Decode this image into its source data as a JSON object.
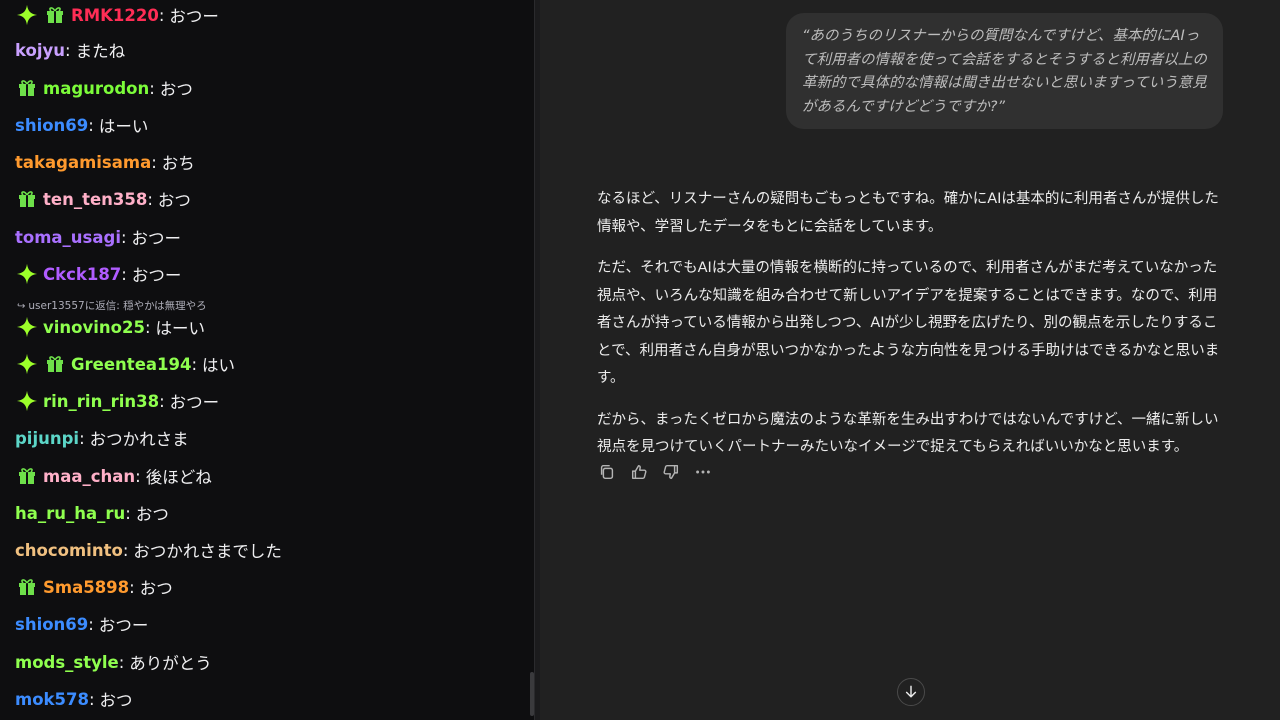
{
  "chat": {
    "messages": [
      {
        "user": "RMK1220",
        "text": "おつー",
        "color": "#ff2d55",
        "badges": [
          "sparkle-icon",
          "gift-icon"
        ]
      },
      {
        "user": "kojyu",
        "text": "またね",
        "color": "#c9a0ff",
        "badges": []
      },
      {
        "user": "magurodon",
        "text": "おつ",
        "color": "#7cfc3a",
        "badges": [
          "gift-icon"
        ]
      },
      {
        "user": "shion69",
        "text": "はーい",
        "color": "#3c8cff",
        "badges": []
      },
      {
        "user": "takagamisama",
        "text": "おち",
        "color": "#ff9a2e",
        "badges": []
      },
      {
        "user": "ten_ten358",
        "text": "おつ",
        "color": "#ffb0c8",
        "badges": [
          "gift-icon"
        ]
      },
      {
        "user": "toma_usagi",
        "text": "おつー",
        "color": "#a970ff",
        "badges": []
      },
      {
        "user": "Ckck187",
        "text": "おつー",
        "color": "#b05cff",
        "badges": [
          "sparkle-icon"
        ]
      },
      {
        "user": "vinovino25",
        "text": "はーい",
        "color": "#8fff4f",
        "badges": [
          "sparkle-icon"
        ]
      },
      {
        "user": "Greentea194",
        "text": "はい",
        "color": "#8fff4f",
        "badges": [
          "sparkle-icon",
          "gift-icon"
        ]
      },
      {
        "user": "rin_rin_rin38",
        "text": "おつー",
        "color": "#8fff4f",
        "badges": [
          "sparkle-icon"
        ]
      },
      {
        "user": "pijunpi",
        "text": "おつかれさま",
        "color": "#5cd6c8",
        "badges": []
      },
      {
        "user": "maa_chan",
        "text": "後ほどね",
        "color": "#ffb0c8",
        "badges": [
          "gift-icon"
        ]
      },
      {
        "user": "ha_ru_ha_ru",
        "text": "おつ",
        "color": "#8fff4f",
        "badges": []
      },
      {
        "user": "chocominto",
        "text": "おつかれさまでした",
        "color": "#f0c080",
        "badges": []
      },
      {
        "user": "Sma5898",
        "text": "おつ",
        "color": "#ff9a2e",
        "badges": [
          "gift-icon"
        ]
      },
      {
        "user": "shion69",
        "text": "おつー",
        "color": "#3c8cff",
        "badges": []
      },
      {
        "user": "mods_style",
        "text": "ありがとう",
        "color": "#8fff4f",
        "badges": []
      },
      {
        "user": "mok578",
        "text": "おつ",
        "color": "#3c8cff",
        "badges": []
      }
    ],
    "reply_context": "user13557に返信: 穏やかは無理やろ"
  },
  "assistant": {
    "user_message": "“あのうちのリスナーからの質問なんですけど、基本的にAIって利用者の情報を使って会話をするとそうすると利用者以上の革新的で具体的な情報は聞き出せないと思いますっていう意見があるんですけどどうですか?”",
    "answer": [
      "なるほど、リスナーさんの疑問もごもっともですね。確かにAIは基本的に利用者さんが提供した情報や、学習したデータをもとに会話をしています。",
      "ただ、それでもAIは大量の情報を横断的に持っているので、利用者さんがまだ考えていなかった視点や、いろんな知識を組み合わせて新しいアイデアを提案することはできます。なので、利用者さんが持っている情報から出発しつつ、AIが少し視野を広げたり、別の観点を示したりすることで、利用者さん自身が思いつかなかったような方向性を見つける手助けはできるかなと思います。",
      "だから、まったくゼロから魔法のような革新を生み出すわけではないんですけど、一緒に新しい視点を見つけていくパートナーみたいなイメージで捉えてもらえればいいかなと思います。"
    ],
    "actions": [
      "copy-icon",
      "thumbs-up-icon",
      "thumbs-down-icon",
      "more-icon"
    ]
  },
  "colors": {
    "chat_bg": "#0e0e10",
    "assistant_bg": "#212121",
    "bubble_bg": "#303030",
    "sparkle": "#9dff2a",
    "gift": "#6ee04a"
  }
}
